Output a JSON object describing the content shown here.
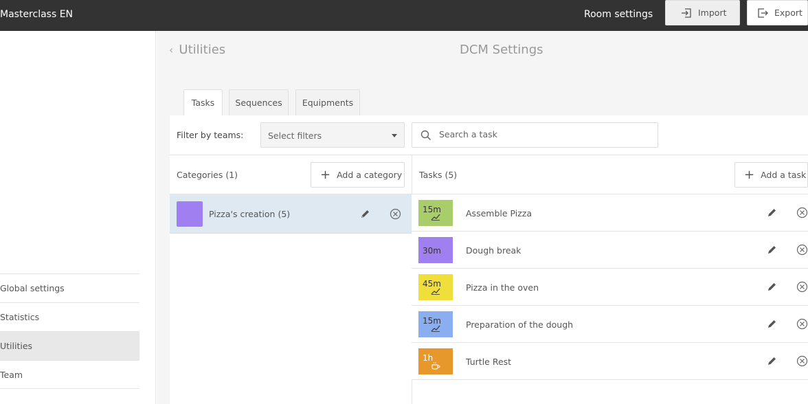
{
  "app_title": "Masterclass EN",
  "window_title": "Room settings",
  "sidebar": {
    "items": [
      {
        "label": "Global settings",
        "active": false
      },
      {
        "label": "Statistics",
        "active": false
      },
      {
        "label": "Utilities",
        "active": true
      },
      {
        "label": "Team",
        "active": false
      }
    ]
  },
  "header": {
    "back_label": "Utilities",
    "page_title": "DCM Settings"
  },
  "tabs": [
    {
      "label": "Tasks",
      "active": true
    },
    {
      "label": "Sequences",
      "active": false
    },
    {
      "label": "Equipments",
      "active": false
    }
  ],
  "toolbar": {
    "filter_label": "Filter by teams:",
    "filter_select": "Select filters",
    "search_placeholder": "Search a task",
    "import_label": "Import",
    "export_label": "Export"
  },
  "categories": {
    "header": "Categories (1)",
    "add_label": "Add a category",
    "items": [
      {
        "name": "Pizza's creation (5)",
        "color": "#a07ff0"
      }
    ]
  },
  "tasks": {
    "header": "Tasks (5)",
    "add_label": "Add a task",
    "items": [
      {
        "duration": "15m",
        "name": "Assemble Pizza",
        "color": "#a9cd6b",
        "icon": "trend-icon"
      },
      {
        "duration": "30m",
        "name": "Dough break",
        "color": "#a07ff0",
        "icon": ""
      },
      {
        "duration": "45m",
        "name": "Pizza in the oven",
        "color": "#f0de3b",
        "icon": "trend-icon"
      },
      {
        "duration": "15m",
        "name": "Preparation of the dough",
        "color": "#8aaef0",
        "icon": "trend-icon"
      },
      {
        "duration": "1h",
        "name": "Turtle Rest",
        "color": "#e8982b",
        "icon": "coffee-icon"
      }
    ]
  },
  "colors": {
    "topbar": "#333333",
    "active_row": "#dfe9f2"
  }
}
